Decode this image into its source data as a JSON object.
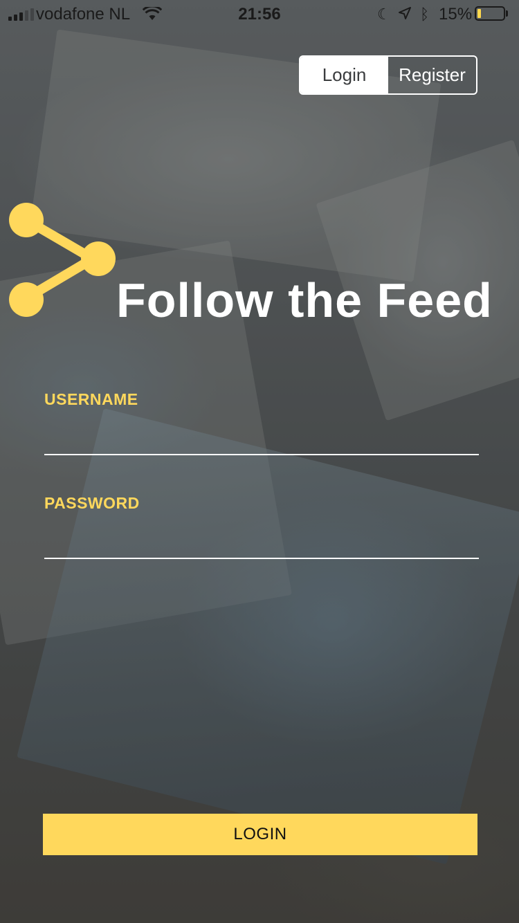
{
  "status_bar": {
    "carrier": "vodafone NL",
    "time": "21:56",
    "battery_percent": "15%",
    "battery_level": 0.15,
    "icons": [
      "signal-icon",
      "wifi-icon",
      "moon-icon",
      "location-icon",
      "bluetooth-icon",
      "battery-icon"
    ]
  },
  "auth_toggle": {
    "login_label": "Login",
    "register_label": "Register",
    "selected": "Login"
  },
  "brand": {
    "title": "Follow the Feed",
    "logo_icon": "share-icon",
    "accent_color": "#ffd85c"
  },
  "form": {
    "username_label": "USERNAME",
    "username_value": "",
    "password_label": "PASSWORD",
    "password_value": "",
    "submit_label": "LOGIN"
  }
}
